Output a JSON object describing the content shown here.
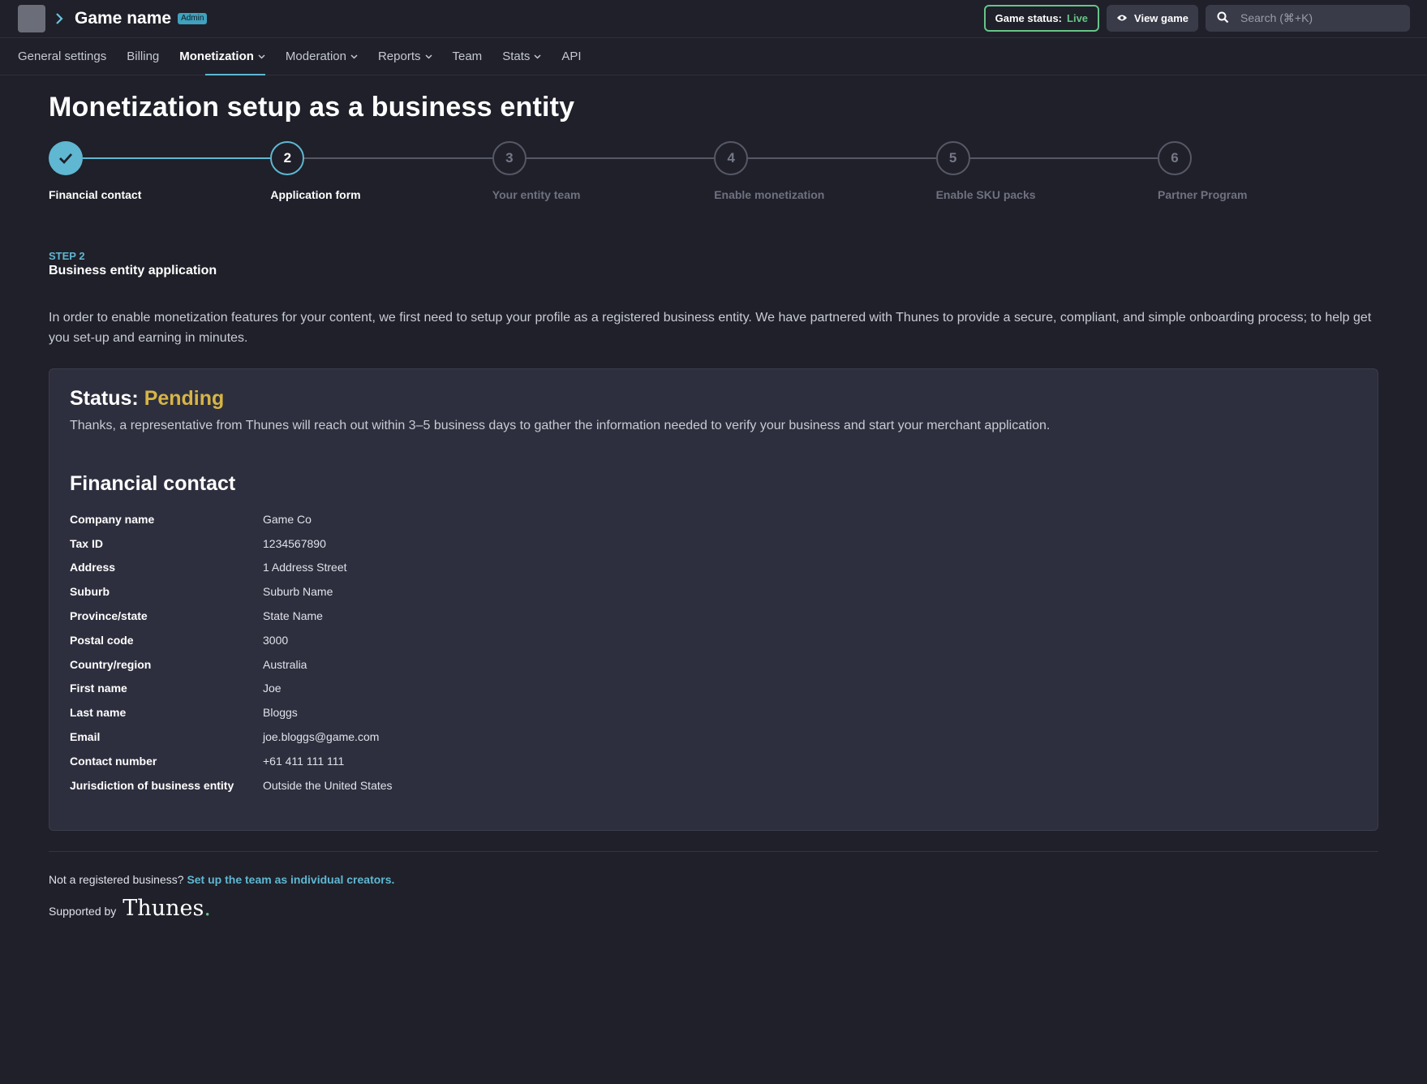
{
  "header": {
    "game_name": "Game name",
    "role_badge": "Admin",
    "game_status_label": "Game status:",
    "game_status_value": "Live",
    "view_game_label": "View game",
    "search_placeholder": "Search (⌘+K)"
  },
  "tabs": [
    {
      "label": "General settings",
      "dropdown": false,
      "active": false
    },
    {
      "label": "Billing",
      "dropdown": false,
      "active": false
    },
    {
      "label": "Monetization",
      "dropdown": true,
      "active": true
    },
    {
      "label": "Moderation",
      "dropdown": true,
      "active": false
    },
    {
      "label": "Reports",
      "dropdown": true,
      "active": false
    },
    {
      "label": "Team",
      "dropdown": false,
      "active": false
    },
    {
      "label": "Stats",
      "dropdown": true,
      "active": false
    },
    {
      "label": "API",
      "dropdown": false,
      "active": false
    }
  ],
  "page_title": "Monetization setup as a business entity",
  "steps": [
    {
      "number": "1",
      "label": "Financial contact",
      "state": "done"
    },
    {
      "number": "2",
      "label": "Application form",
      "state": "current"
    },
    {
      "number": "3",
      "label": "Your entity team",
      "state": "todo"
    },
    {
      "number": "4",
      "label": "Enable monetization",
      "state": "todo"
    },
    {
      "number": "5",
      "label": "Enable SKU packs",
      "state": "todo"
    },
    {
      "number": "6",
      "label": "Partner Program",
      "state": "todo"
    }
  ],
  "step_section": {
    "tag": "STEP 2",
    "title": "Business entity application",
    "intro": "In order to enable monetization features for your content, we first need to setup your profile as a registered business entity. We have partnered with Thunes to provide a secure, compliant, and simple onboarding process; to help get you set-up and earning in minutes."
  },
  "status_card": {
    "status_label": "Status:",
    "status_value": "Pending",
    "message": "Thanks, a representative from Thunes will reach out within 3–5 business days to gather the information needed to verify your business and start your merchant application.",
    "financial_contact_title": "Financial contact",
    "fields": [
      {
        "key": "Company name",
        "value": "Game Co"
      },
      {
        "key": "Tax ID",
        "value": "1234567890"
      },
      {
        "key": "Address",
        "value": "1 Address Street"
      },
      {
        "key": "Suburb",
        "value": "Suburb Name"
      },
      {
        "key": "Province/state",
        "value": "State Name"
      },
      {
        "key": "Postal code",
        "value": "3000"
      },
      {
        "key": "Country/region",
        "value": "Australia"
      },
      {
        "key": "First name",
        "value": "Joe"
      },
      {
        "key": "Last name",
        "value": "Bloggs"
      },
      {
        "key": "Email",
        "value": "joe.bloggs@game.com"
      },
      {
        "key": "Contact number",
        "value": "+61 411 111 111"
      },
      {
        "key": "Jurisdiction of business entity",
        "value": "Outside the United States"
      }
    ]
  },
  "footer": {
    "note": "Not a registered business?",
    "link": "Set up the team as individual creators.",
    "supported_by": "Supported by",
    "logo_text": "Thunes",
    "logo_dot": "."
  },
  "colors": {
    "accent": "#5fb7d2",
    "live": "#67c488",
    "pending": "#d7b545",
    "background": "#1f2029",
    "card": "#2e2f3e"
  }
}
